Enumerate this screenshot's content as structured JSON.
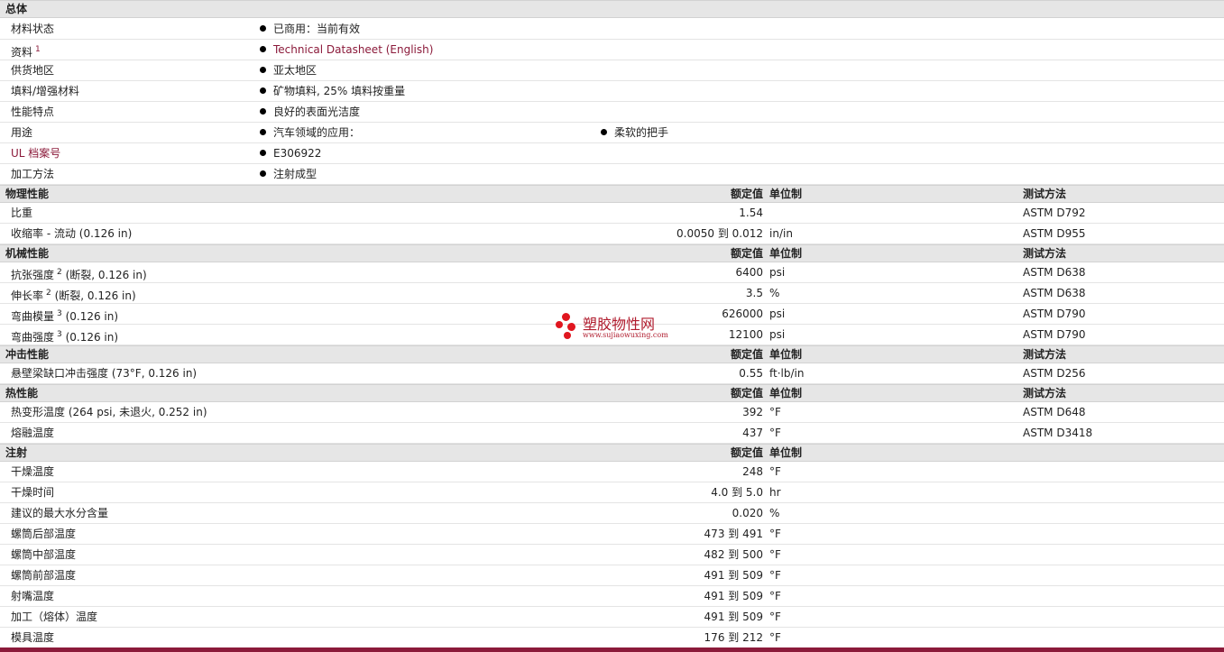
{
  "sections": {
    "general": {
      "title": "总体"
    },
    "physical": {
      "title": "物理性能"
    },
    "mechanical": {
      "title": "机械性能"
    },
    "impact": {
      "title": "冲击性能"
    },
    "thermal": {
      "title": "热性能"
    },
    "injection": {
      "title": "注射"
    }
  },
  "headers": {
    "value": "额定值",
    "unit": "单位制",
    "test": "测试方法"
  },
  "general": [
    {
      "label": "材料状态",
      "value": "已商用：当前有效"
    },
    {
      "label": "资料",
      "sup": "1",
      "value": "Technical Datasheet (English)"
    },
    {
      "label": "供货地区",
      "value": "亚太地区"
    },
    {
      "label": "填料/增强材料",
      "value": "矿物填料, 25% 填料按重量"
    },
    {
      "label": "性能特点",
      "value": "良好的表面光洁度"
    },
    {
      "label": "用途",
      "value": "汽车领域的应用：",
      "value2": "柔软的把手"
    },
    {
      "label": "UL 档案号",
      "value": "E306922"
    },
    {
      "label": "加工方法",
      "value": "注射成型"
    }
  ],
  "physical": [
    {
      "label": "比重",
      "cond": "",
      "value": "1.54",
      "unit": "",
      "test": "ASTM D792"
    },
    {
      "label": "收缩率 - 流动",
      "cond": "(0.126 in)",
      "value": "0.0050 到  0.012",
      "unit": "in/in",
      "test": "ASTM D955"
    }
  ],
  "mechanical": [
    {
      "label": "抗张强度",
      "sup": "2",
      "cond": "(断裂, 0.126 in)",
      "value": "6400",
      "unit": "psi",
      "test": "ASTM D638"
    },
    {
      "label": "伸长率",
      "sup": "2",
      "cond": "(断裂, 0.126 in)",
      "value": "3.5",
      "unit": "%",
      "test": "ASTM D638"
    },
    {
      "label": "弯曲模量",
      "sup": "3",
      "cond": "(0.126 in)",
      "value": "626000",
      "unit": "psi",
      "test": "ASTM D790"
    },
    {
      "label": "弯曲强度",
      "sup": "3",
      "cond": "(0.126 in)",
      "value": "12100",
      "unit": "psi",
      "test": "ASTM D790"
    }
  ],
  "impact": [
    {
      "label": "悬壁梁缺口冲击强度",
      "cond": "(73°F, 0.126 in)",
      "value": "0.55",
      "unit": "ft·lb/in",
      "test": "ASTM D256"
    }
  ],
  "thermal": [
    {
      "label": "热变形温度",
      "cond": "(264 psi, 未退火, 0.252 in)",
      "value": "392",
      "unit": "°F",
      "test": "ASTM D648"
    },
    {
      "label": "熔融温度",
      "cond": "",
      "value": "437",
      "unit": "°F",
      "test": "ASTM D3418"
    }
  ],
  "injection": [
    {
      "label": "干燥温度",
      "value": "248",
      "unit": "°F"
    },
    {
      "label": "干燥时间",
      "value": "4.0 到  5.0",
      "unit": "hr"
    },
    {
      "label": "建议的最大水分含量",
      "value": "0.020",
      "unit": "%"
    },
    {
      "label": "螺筒后部温度",
      "value": "473 到  491",
      "unit": "°F"
    },
    {
      "label": "螺筒中部温度",
      "value": "482 到  500",
      "unit": "°F"
    },
    {
      "label": "螺筒前部温度",
      "value": "491 到  509",
      "unit": "°F"
    },
    {
      "label": "射嘴温度",
      "value": "491 到  509",
      "unit": "°F"
    },
    {
      "label": "加工（熔体）温度",
      "value": "491 到  509",
      "unit": "°F"
    },
    {
      "label": "模具温度",
      "value": "176 到  212",
      "unit": "°F"
    }
  ],
  "watermark": {
    "name": "塑胶物性网",
    "url": "www.sujiaowuxing.com"
  },
  "colors": {
    "link": "#8b1a3a",
    "section_bg": "#e6e6e6",
    "watermark": "#e0161f"
  }
}
